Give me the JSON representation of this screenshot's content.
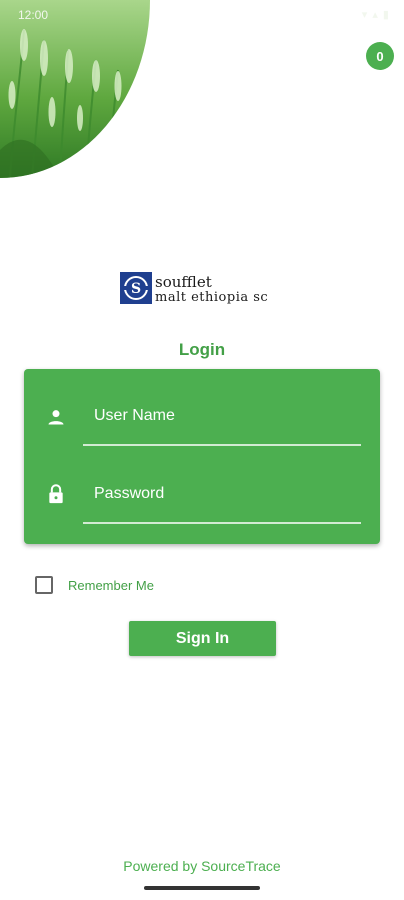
{
  "status_bar": {
    "time": "12:00",
    "icons": "▾ ▴ ▮"
  },
  "hero": {
    "image": "wheat-field"
  },
  "badge": {
    "count": "0"
  },
  "logo": {
    "line1": "soufflet",
    "line2": "malt ethiopia sc",
    "mark_letter": "S"
  },
  "login": {
    "title": "Login"
  },
  "form": {
    "username_placeholder": "User Name",
    "password_placeholder": "Password",
    "remember_label": "Remember Me",
    "remember_checked": false,
    "submit_label": "Sign In"
  },
  "footer": {
    "powered_by": "Powered by SourceTrace"
  },
  "colors": {
    "accent": "#4caf50",
    "accent_text": "#43a047",
    "background": "#ffffff"
  }
}
